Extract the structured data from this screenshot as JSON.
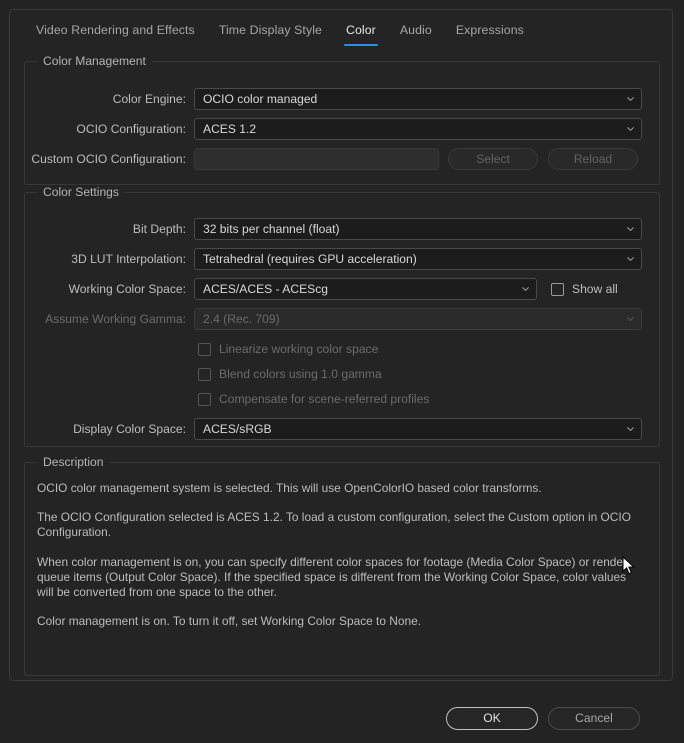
{
  "colors": {
    "accent": "#2d8ceb",
    "panel_bg": "#242424",
    "window_bg": "#232323",
    "field_bg": "#1c1c1c",
    "text": "#c8c8c8",
    "text_disabled": "#6b6b6b"
  },
  "tabs": [
    {
      "label": "Video Rendering and Effects",
      "active": false
    },
    {
      "label": "Time Display Style",
      "active": false
    },
    {
      "label": "Color",
      "active": true
    },
    {
      "label": "Audio",
      "active": false
    },
    {
      "label": "Expressions",
      "active": false
    }
  ],
  "color_management": {
    "legend": "Color Management",
    "color_engine": {
      "label": "Color Engine:",
      "value": "OCIO color managed"
    },
    "ocio_configuration": {
      "label": "OCIO Configuration:",
      "value": "ACES 1.2"
    },
    "custom_ocio_configuration": {
      "label": "Custom OCIO Configuration:",
      "value": "",
      "select_button": "Select",
      "reload_button": "Reload"
    }
  },
  "color_settings": {
    "legend": "Color Settings",
    "bit_depth": {
      "label": "Bit Depth:",
      "value": "32 bits per channel (float)"
    },
    "lut_interpolation": {
      "label": "3D LUT Interpolation:",
      "value": "Tetrahedral (requires GPU acceleration)"
    },
    "working_color_space": {
      "label": "Working Color Space:",
      "value": "ACES/ACES - ACEScg",
      "show_all_label": "Show all",
      "show_all_checked": false
    },
    "assume_working_gamma": {
      "label": "Assume Working Gamma:",
      "value": "2.4 (Rec. 709)"
    },
    "linearize": {
      "label": "Linearize working color space",
      "checked": false
    },
    "blend_10_gamma": {
      "label": "Blend colors using 1.0 gamma",
      "checked": false
    },
    "compensate_scene_referred": {
      "label": "Compensate for scene-referred profiles",
      "checked": false
    },
    "display_color_space": {
      "label": "Display Color Space:",
      "value": "ACES/sRGB"
    }
  },
  "description": {
    "legend": "Description",
    "paragraphs": [
      "OCIO color management system is selected. This will use OpenColorIO based color transforms.",
      "The OCIO Configuration selected is ACES 1.2. To load a custom configuration, select the Custom option in OCIO Configuration.",
      "When color management is on, you can specify different color spaces for footage (Media Color Space) or render queue items (Output Color Space). If the specified space is different from the Working Color Space, color values will be converted from one space to the other.",
      "Color management is on. To turn it off, set Working Color Space to None."
    ]
  },
  "footer": {
    "ok_label": "OK",
    "cancel_label": "Cancel"
  }
}
